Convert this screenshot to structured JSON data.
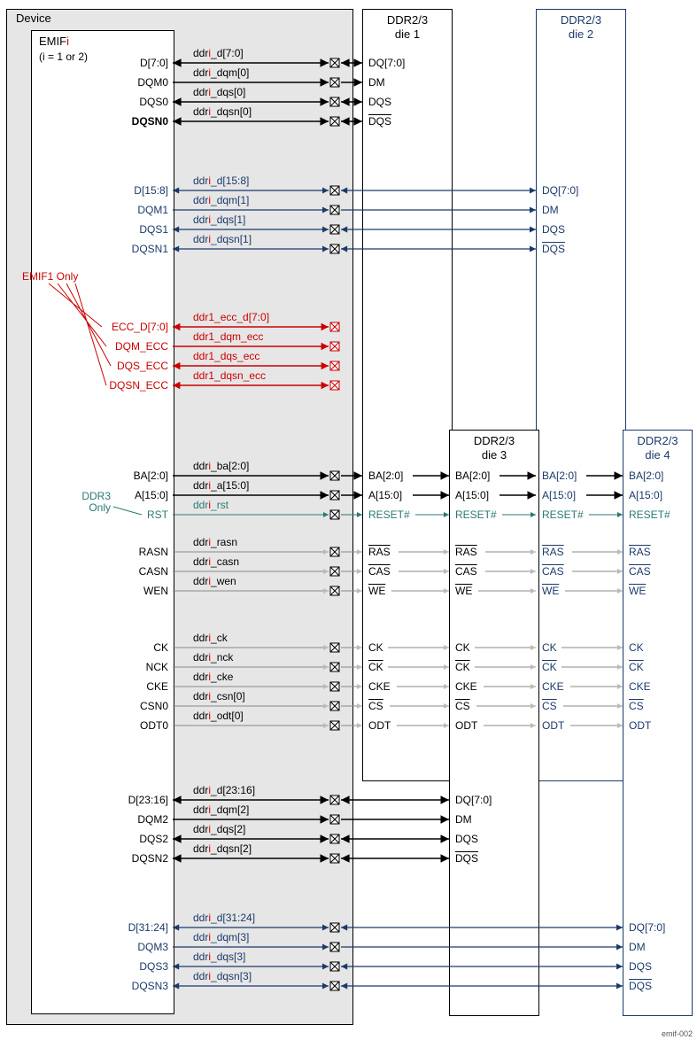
{
  "device_label": "Device",
  "emif_label_prefix": "EMIF",
  "emif_label_i": "i",
  "emif_sublabel": "(i = 1 or 2)",
  "emif1_only_label": "EMIF1 Only",
  "ddr3_only_label": "DDR3\nOnly",
  "tiny_id": "emif-002",
  "dies": {
    "die1": {
      "title_l1": "DDR2/3",
      "title_l2": "die 1"
    },
    "die2": {
      "title_l1": "DDR2/3",
      "title_l2": "die 2"
    },
    "die3": {
      "title_l1": "DDR2/3",
      "title_l2": "die 3"
    },
    "die4": {
      "title_l1": "DDR2/3",
      "title_l2": "die 4"
    }
  },
  "emif_pins": {
    "d70": "D[7:0]",
    "dqm0": "DQM0",
    "dqs0": "DQS0",
    "dqsn0": "DQSN0",
    "d158": "D[15:8]",
    "dqm1": "DQM1",
    "dqs1": "DQS1",
    "dqsn1": "DQSN1",
    "ecc_d": "ECC_D[7:0]",
    "dqm_ecc": "DQM_ECC",
    "dqs_ecc": "DQS_ECC",
    "dqsn_ecc": "DQSN_ECC",
    "ba": "BA[2:0]",
    "a": "A[15:0]",
    "rst": "RST",
    "rasn": "RASN",
    "casn": "CASN",
    "wen": "WEN",
    "ck": "CK",
    "nck": "NCK",
    "cke": "CKE",
    "csn0": "CSN0",
    "odt0": "ODT0",
    "d2316": "D[23:16]",
    "dqm2": "DQM2",
    "dqs2": "DQS2",
    "dqsn2": "DQSN2",
    "d3124": "D[31:24]",
    "dqm3": "DQM3",
    "dqs3": "DQS3",
    "dqsn3": "DQSN3"
  },
  "net_labels": {
    "d70": "_d[7:0]",
    "dqm0": "_dqm[0]",
    "dqs0": "_dqs[0]",
    "dqsn0": "_dqsn[0]",
    "d158": "_d[15:8]",
    "dqm1": "_dqm[1]",
    "dqs1": "_dqs[1]",
    "dqsn1": "_dqsn[1]",
    "ecc_d": "ddr1_ecc_d[7:0]",
    "dqm_ecc": "ddr1_dqm_ecc",
    "dqs_ecc": "ddr1_dqs_ecc",
    "dqsn_ecc": "ddr1_dqsn_ecc",
    "ba": "_ba[2:0]",
    "a": "_a[15:0]",
    "rst": "_rst",
    "rasn": "_rasn",
    "casn": "_casn",
    "wen": "_wen",
    "ck": "_ck",
    "nck": "_nck",
    "cke": "_cke",
    "csn0": "_csn[0]",
    "odt0": "_odt[0]",
    "d2316": "_d[23:16]",
    "dqm2": "_dqm[2]",
    "dqs2": "_dqs[2]",
    "dqsn2": "_dqsn[2]",
    "d3124": "_d[31:24]",
    "dqm3": "_dqm[3]",
    "dqs3": "_dqs[3]",
    "dqsn3": "_dqsn[3]",
    "prefix": "ddr"
  },
  "die_pins": {
    "dq": "DQ[7:0]",
    "dm": "DM",
    "dqs": "DQS",
    "dqs_n": "DQS",
    "ba": "BA[2:0]",
    "a": "A[15:0]",
    "reset": "RESET#",
    "ras": "RAS",
    "cas": "CAS",
    "we": "WE",
    "ck": "CK",
    "ck_n": "CK",
    "cke": "CKE",
    "cs": "CS",
    "odt": "ODT"
  }
}
